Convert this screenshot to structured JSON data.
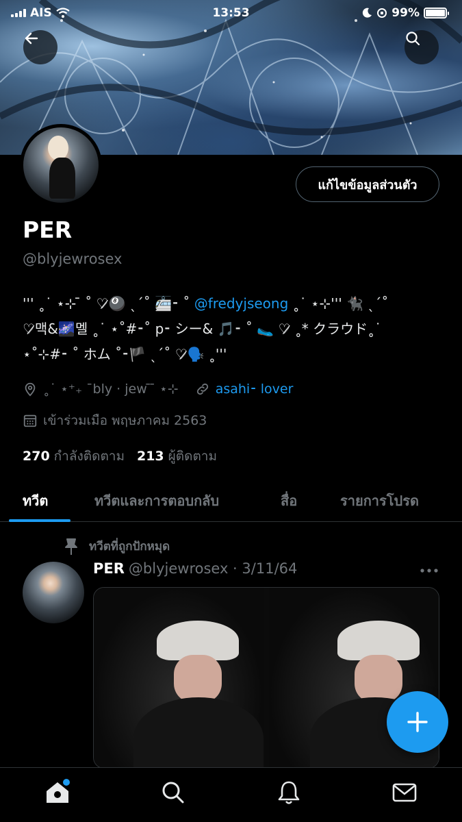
{
  "status_bar": {
    "carrier": "AIS",
    "time": "13:53",
    "battery": "99%",
    "battery_level": 0.99
  },
  "profile": {
    "edit_button": "แก้ไขข้อมูลส่วนตัว",
    "display_name": "PER",
    "handle": "@blyjewrosex",
    "bio": {
      "line1_pre": "''' ˳˙ ⋆⊹ ̄ ˚ ♡̷🎱 ˎˊ˚ 🚈⁃ ˚ ",
      "line1_mention": "@fredyjseong",
      "line1_post": " ˳˙ ⋆⊹''' 🐈‍⬛ ˎˊ˚",
      "line2": "♡̷맥&🌌멜 ˳˙ ⋆˚#⁃˚ p⁃ シー& 🎵⁃ ˚ 🥿 ♡̷ ˳* クラウド˳˙",
      "line3": "⋆˚⊹#⁃ ˚ ホム ˚⁃🏴 ˎˊ˚ ♡̷🗣️ ˳'''"
    },
    "location": "˳˙ ⋆⁺₊ ¯bly · jew ̄ ̄ ⋆⊹",
    "website": "asahi⁃ lover",
    "joined": "เข้าร่วมเมือ พฤษภาคม 2563",
    "following_count": "270",
    "following_label": "กำลังติดตาม",
    "followers_count": "213",
    "followers_label": "ผู้ติดตาม"
  },
  "tabs": [
    {
      "label": "ทวีต",
      "active": true
    },
    {
      "label": "ทวีตและการตอบกลับ",
      "active": false
    },
    {
      "label": "สื่อ",
      "active": false
    },
    {
      "label": "รายการโปรด",
      "active": false
    }
  ],
  "pinned_tweet": {
    "pinned_label": "ทวีตที่ถูกปักหมุด",
    "author": "PER",
    "handle_date": "@blyjewrosex · 3/11/64"
  },
  "icons": {
    "back": "arrow-left-icon",
    "search": "search-icon",
    "location": "location-pin-icon",
    "link": "link-icon",
    "calendar": "calendar-icon",
    "pin": "pushpin-icon",
    "more": "more-dots-icon",
    "compose": "plus-icon",
    "home": "home-icon",
    "explore": "search-icon",
    "notifications": "bell-icon",
    "messages": "mail-icon"
  },
  "colors": {
    "accent": "#1d9bf0",
    "background": "#000000",
    "muted_text": "#71767b"
  }
}
